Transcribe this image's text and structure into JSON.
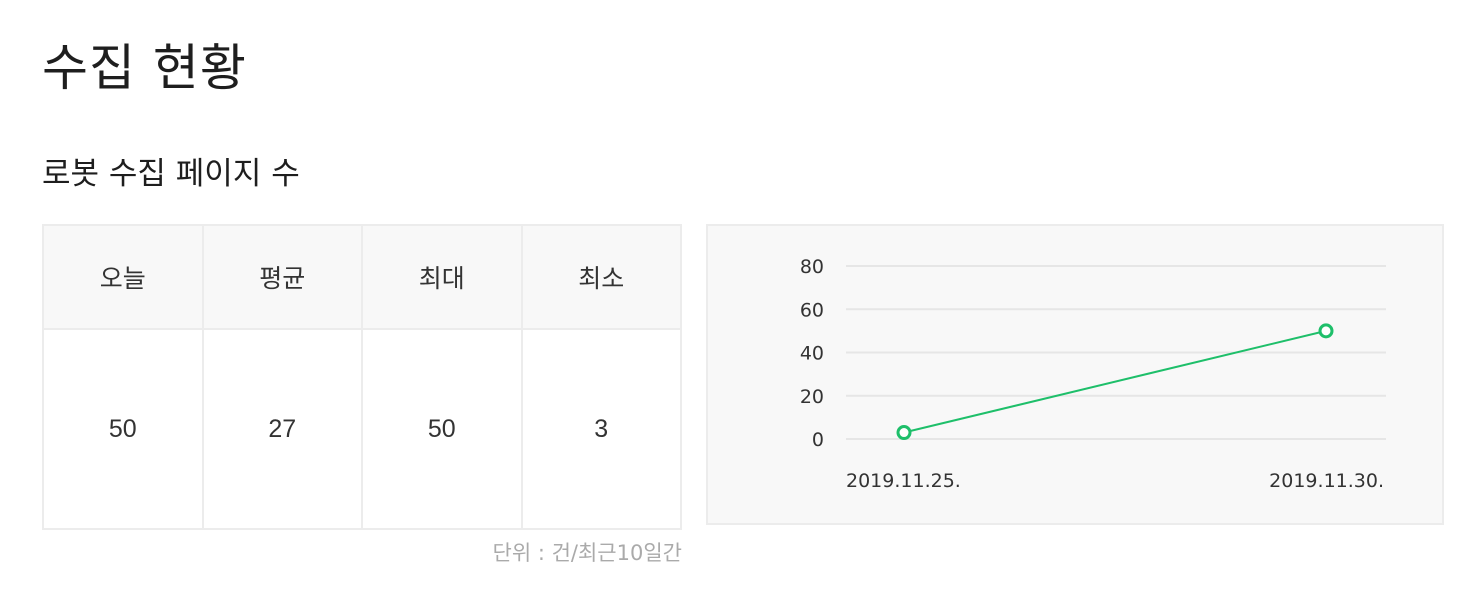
{
  "page": {
    "title": "수집 현황",
    "section_title": "로봇 수집 페이지 수",
    "unit_note": "단위 : 건/최근10일간"
  },
  "stats": {
    "headers": [
      "오늘",
      "평균",
      "최대",
      "최소"
    ],
    "values": [
      "50",
      "27",
      "50",
      "3"
    ]
  },
  "colors": {
    "line": "#1ebf6a",
    "grid": "#e6e6e6",
    "panel_bg": "#f8f8f8"
  },
  "chart_data": {
    "type": "line",
    "title": "",
    "xlabel": "",
    "ylabel": "",
    "x": [
      "2019.11.25.",
      "2019.11.30."
    ],
    "series": [
      {
        "values": [
          3,
          50
        ]
      }
    ],
    "ylim": [
      0,
      80
    ],
    "yticks": [
      0,
      20,
      40,
      60,
      80
    ],
    "grid": true,
    "markers": "hollow-circle"
  }
}
